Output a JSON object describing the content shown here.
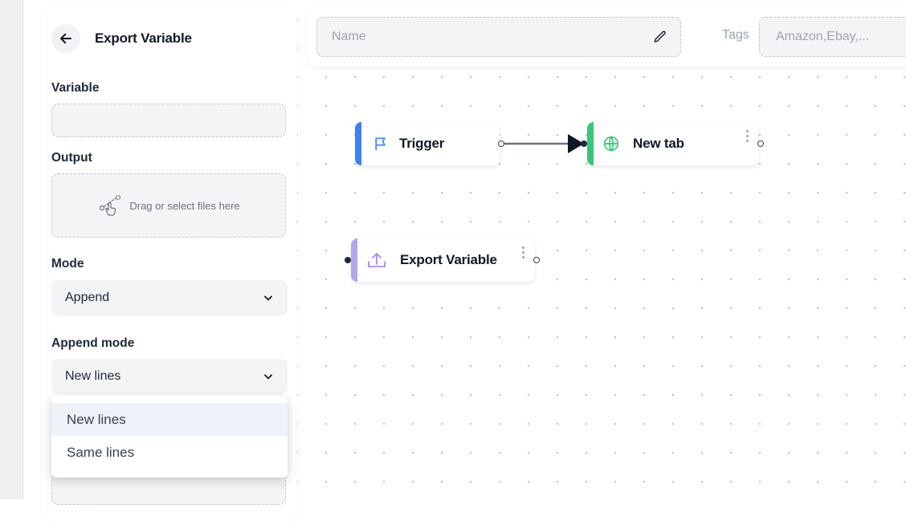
{
  "panel": {
    "title": "Export Variable",
    "variable": {
      "label": "Variable",
      "value": ""
    },
    "output": {
      "label": "Output",
      "drop_text": "Drag or select files here"
    },
    "mode": {
      "label": "Mode",
      "value": "Append"
    },
    "append_mode": {
      "label": "Append mode",
      "value": "New lines",
      "options": [
        "New lines",
        "Same lines"
      ]
    }
  },
  "topbar": {
    "name_placeholder": "Name",
    "tags_label": "Tags",
    "tags_placeholder": "Amazon,Ebay,..."
  },
  "nodes": {
    "trigger": {
      "label": "Trigger",
      "accent": "#3b82f6"
    },
    "new_tab": {
      "label": "New tab",
      "accent": "#34c77b"
    },
    "export_variable": {
      "label": "Export Variable",
      "accent": "#b4a5f0"
    }
  },
  "colors": {
    "edge": "#6b7280",
    "arrow": "#111827"
  }
}
